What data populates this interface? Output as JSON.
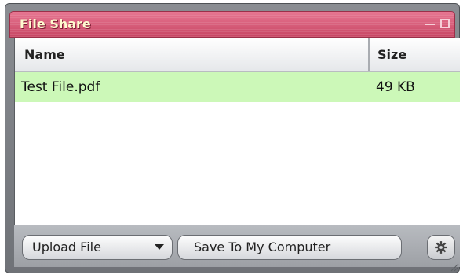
{
  "window": {
    "title": "File Share",
    "controls": {
      "minimize_icon": "minimize-icon",
      "maximize_icon": "maximize-icon"
    }
  },
  "table": {
    "columns": [
      "Name",
      "Size"
    ],
    "rows": [
      {
        "name": "Test File.pdf",
        "size": "49 KB",
        "selected": true
      }
    ]
  },
  "footer": {
    "upload_label": "Upload File",
    "upload_dropdown_icon": "caret-down-icon",
    "save_label": "Save To My Computer",
    "settings_icon": "gear-icon"
  },
  "colors": {
    "titlebar": "#d55a76",
    "title_text": "#fefbd0",
    "selected_row": "#ccf8b8",
    "frame": "#7e8186"
  }
}
